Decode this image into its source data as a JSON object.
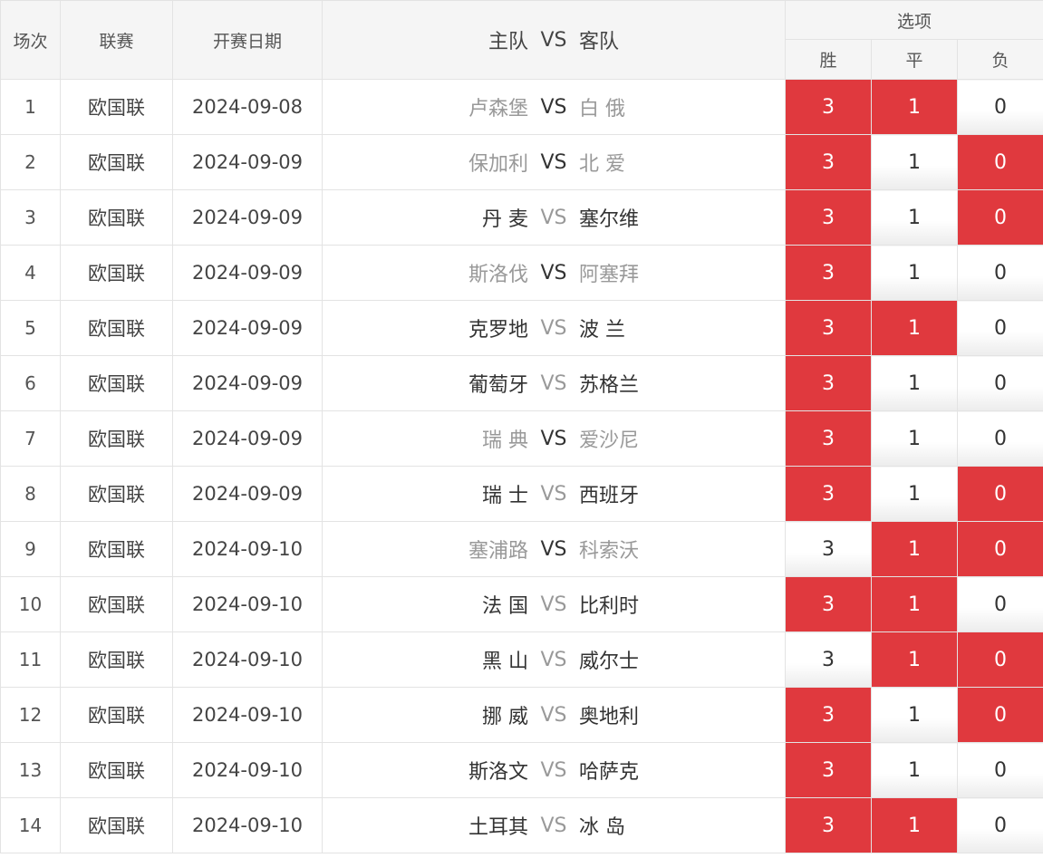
{
  "header": {
    "col_index": "场次",
    "col_league": "联赛",
    "col_date": "开赛日期",
    "col_home": "主队",
    "col_vs": "VS",
    "col_away": "客队",
    "col_options": "选项",
    "opt_win": "胜",
    "opt_draw": "平",
    "opt_lose": "负"
  },
  "colors": {
    "selected": "#e0393e",
    "muted_text": "#999999",
    "normal_text": "#333333"
  },
  "rows": [
    {
      "no": "1",
      "league": "欧国联",
      "date": "2024-09-08",
      "home": "卢森堡",
      "away": "白 俄",
      "home_dim": true,
      "vs_dim": false,
      "away_dim": true,
      "win": "3",
      "draw": "1",
      "lose": "0",
      "sel": [
        true,
        true,
        false
      ]
    },
    {
      "no": "2",
      "league": "欧国联",
      "date": "2024-09-09",
      "home": "保加利",
      "away": "北 爱",
      "home_dim": true,
      "vs_dim": false,
      "away_dim": true,
      "win": "3",
      "draw": "1",
      "lose": "0",
      "sel": [
        true,
        false,
        true
      ]
    },
    {
      "no": "3",
      "league": "欧国联",
      "date": "2024-09-09",
      "home": "丹 麦",
      "away": "塞尔维",
      "home_dim": false,
      "vs_dim": true,
      "away_dim": false,
      "win": "3",
      "draw": "1",
      "lose": "0",
      "sel": [
        true,
        false,
        true
      ]
    },
    {
      "no": "4",
      "league": "欧国联",
      "date": "2024-09-09",
      "home": "斯洛伐",
      "away": "阿塞拜",
      "home_dim": true,
      "vs_dim": false,
      "away_dim": true,
      "win": "3",
      "draw": "1",
      "lose": "0",
      "sel": [
        true,
        false,
        false
      ]
    },
    {
      "no": "5",
      "league": "欧国联",
      "date": "2024-09-09",
      "home": "克罗地",
      "away": "波 兰",
      "home_dim": false,
      "vs_dim": true,
      "away_dim": false,
      "win": "3",
      "draw": "1",
      "lose": "0",
      "sel": [
        true,
        true,
        false
      ]
    },
    {
      "no": "6",
      "league": "欧国联",
      "date": "2024-09-09",
      "home": "葡萄牙",
      "away": "苏格兰",
      "home_dim": false,
      "vs_dim": true,
      "away_dim": false,
      "win": "3",
      "draw": "1",
      "lose": "0",
      "sel": [
        true,
        false,
        false
      ]
    },
    {
      "no": "7",
      "league": "欧国联",
      "date": "2024-09-09",
      "home": "瑞 典",
      "away": "爱沙尼",
      "home_dim": true,
      "vs_dim": false,
      "away_dim": true,
      "win": "3",
      "draw": "1",
      "lose": "0",
      "sel": [
        true,
        false,
        false
      ]
    },
    {
      "no": "8",
      "league": "欧国联",
      "date": "2024-09-09",
      "home": "瑞 士",
      "away": "西班牙",
      "home_dim": false,
      "vs_dim": true,
      "away_dim": false,
      "win": "3",
      "draw": "1",
      "lose": "0",
      "sel": [
        true,
        false,
        true
      ]
    },
    {
      "no": "9",
      "league": "欧国联",
      "date": "2024-09-10",
      "home": "塞浦路",
      "away": "科索沃",
      "home_dim": true,
      "vs_dim": false,
      "away_dim": true,
      "win": "3",
      "draw": "1",
      "lose": "0",
      "sel": [
        false,
        true,
        true
      ]
    },
    {
      "no": "10",
      "league": "欧国联",
      "date": "2024-09-10",
      "home": "法 国",
      "away": "比利时",
      "home_dim": false,
      "vs_dim": true,
      "away_dim": false,
      "win": "3",
      "draw": "1",
      "lose": "0",
      "sel": [
        true,
        true,
        false
      ]
    },
    {
      "no": "11",
      "league": "欧国联",
      "date": "2024-09-10",
      "home": "黑 山",
      "away": "威尔士",
      "home_dim": false,
      "vs_dim": true,
      "away_dim": false,
      "win": "3",
      "draw": "1",
      "lose": "0",
      "sel": [
        false,
        true,
        true
      ]
    },
    {
      "no": "12",
      "league": "欧国联",
      "date": "2024-09-10",
      "home": "挪 威",
      "away": "奥地利",
      "home_dim": false,
      "vs_dim": true,
      "away_dim": false,
      "win": "3",
      "draw": "1",
      "lose": "0",
      "sel": [
        true,
        false,
        true
      ]
    },
    {
      "no": "13",
      "league": "欧国联",
      "date": "2024-09-10",
      "home": "斯洛文",
      "away": "哈萨克",
      "home_dim": false,
      "vs_dim": true,
      "away_dim": false,
      "win": "3",
      "draw": "1",
      "lose": "0",
      "sel": [
        true,
        false,
        false
      ]
    },
    {
      "no": "14",
      "league": "欧国联",
      "date": "2024-09-10",
      "home": "土耳其",
      "away": "冰 岛",
      "home_dim": false,
      "vs_dim": true,
      "away_dim": false,
      "win": "3",
      "draw": "1",
      "lose": "0",
      "sel": [
        true,
        true,
        false
      ]
    }
  ]
}
